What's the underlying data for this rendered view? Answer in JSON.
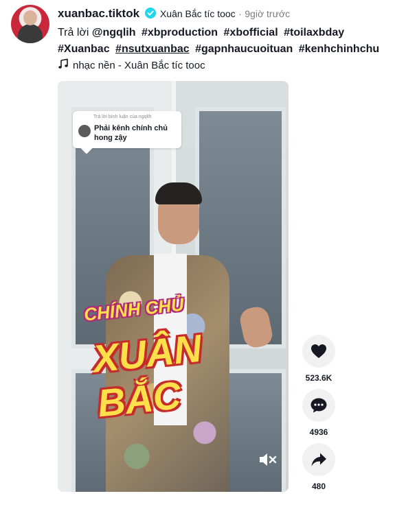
{
  "header": {
    "username": "xuanbac.tiktok",
    "nickname": "Xuân Bắc tíc tooc",
    "separator": "·",
    "time": "9giờ trước"
  },
  "caption": {
    "prefix": "Trả lời",
    "tags": [
      "@ngqlih",
      "#xbproduction",
      "#xbofficial",
      "#toilaxbday",
      "#Xuanbac",
      "#nsutxuanbac",
      "#gapnhaucuoituan",
      "#kenhchinhchu"
    ]
  },
  "music": {
    "icon": "music-note-icon",
    "text": "nhạc nền - Xuân Bắc tíc tooc"
  },
  "video": {
    "reply_header": "Trả lời bình luận của ngqlih",
    "reply_text": "Phải kênh chính chủ hong zậy",
    "overlay_small": "CHÍNH CHỦ",
    "overlay_big": "XUÂN BẮC"
  },
  "actions": {
    "likes": "523.6K",
    "comments": "4936",
    "shares": "480"
  },
  "colors": {
    "text": "#161823",
    "muted": "#7b7b80",
    "verified": "#20d5ec",
    "action_bg": "#f1f1f2",
    "overlay_yellow": "#ffe04a"
  }
}
